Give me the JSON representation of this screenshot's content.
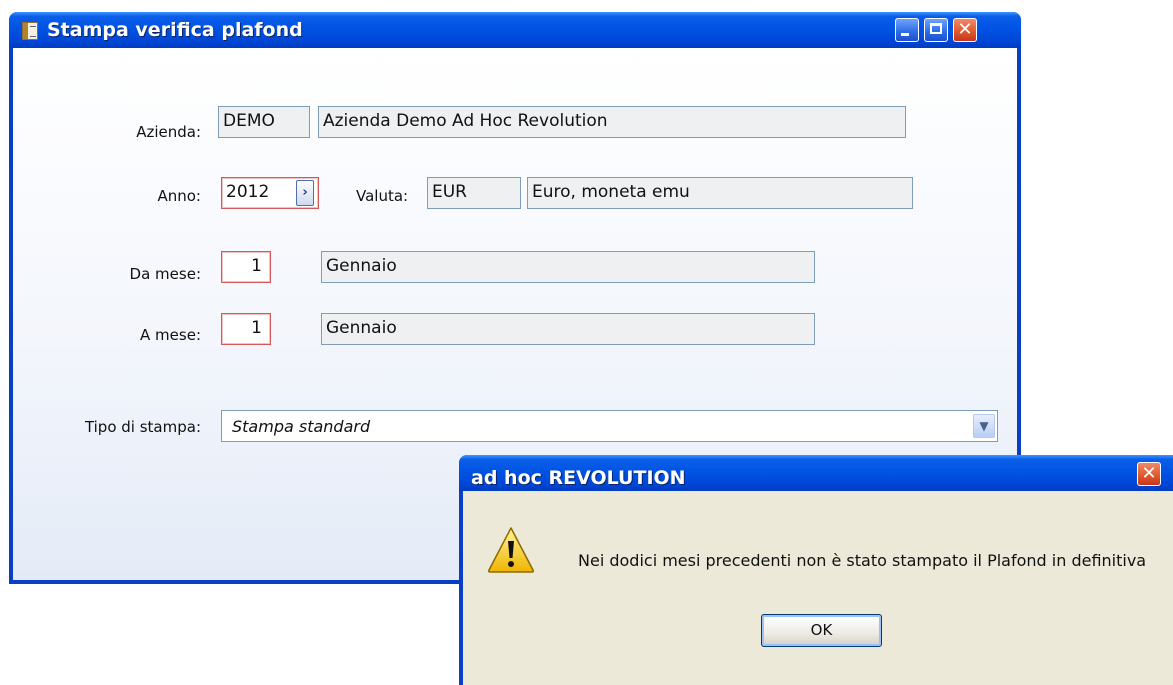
{
  "main_window": {
    "title": "Stampa verifica plafond",
    "azienda": {
      "label": "Azienda:",
      "code": "DEMO",
      "description": "Azienda Demo Ad Hoc Revolution"
    },
    "anno": {
      "label": "Anno:",
      "value": "2012"
    },
    "valuta": {
      "label": "Valuta:",
      "code": "EUR",
      "description": "Euro, moneta emu"
    },
    "da_mese": {
      "label": "Da mese:",
      "value": "1",
      "description": "Gennaio"
    },
    "a_mese": {
      "label": "A mese:",
      "value": "1",
      "description": "Gennaio"
    },
    "tipo_stampa": {
      "label": "Tipo di stampa:",
      "selected": "Stampa standard"
    }
  },
  "dialog": {
    "title": "ad hoc REVOLUTION",
    "icon": "warning-icon",
    "message": "Nei dodici mesi precedenti non è stato stampato il Plafond in definitiva",
    "ok_label": "OK"
  }
}
